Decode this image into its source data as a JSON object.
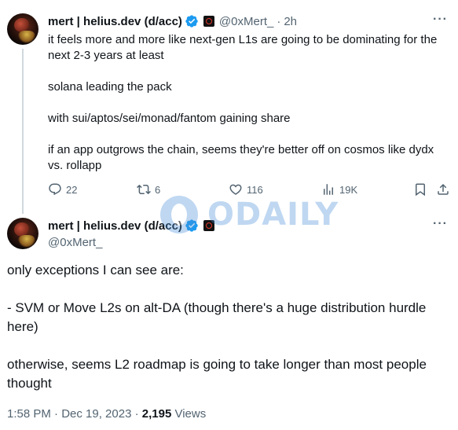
{
  "tweet1": {
    "name": "mert | helius.dev (d/acc)",
    "handle": "@0xMert_",
    "time": "2h",
    "lines": [
      "it feels more and more like next-gen L1s are going to be dominating for the next 2-3 years at least",
      "solana leading the pack",
      "with sui/aptos/sei/monad/fantom gaining share",
      "if an app outgrows the chain, seems they're better off on cosmos like dydx vs. rollapp"
    ],
    "replies": "22",
    "retweets": "6",
    "likes": "116",
    "views": "19K"
  },
  "tweet2": {
    "name": "mert | helius.dev (d/acc)",
    "handle": "@0xMert_",
    "paragraphs": [
      "only exceptions I can see are:",
      "- SVM or Move L2s on alt-DA (though there's a huge distribution hurdle here)",
      "otherwise, seems L2 roadmap is going to take longer than most people thought"
    ],
    "timestamp": "1:58 PM · Dec 19, 2023 · ",
    "views_count": "2,195",
    "views_label": " Views"
  },
  "watermark": {
    "text": "ODAILY"
  },
  "icons": {
    "verified": "verified-badge-icon",
    "reply": "reply-icon",
    "retweet": "retweet-icon",
    "like": "heart-icon",
    "views": "views-icon",
    "bookmark": "bookmark-icon",
    "share": "share-icon",
    "more": "more-icon"
  },
  "colors": {
    "accent": "#1d9bf0",
    "muted": "#536471",
    "text": "#0f1419"
  }
}
